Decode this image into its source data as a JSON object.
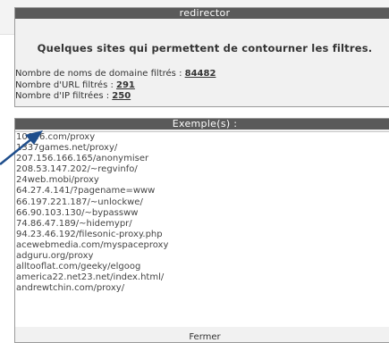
{
  "panel_title": "redirector",
  "subtitle": "Quelques sites qui permettent de contourner les filtres.",
  "stats": [
    {
      "label": "Nombre de noms de domaine filtrés : ",
      "value": "84482"
    },
    {
      "label": "Nombre d'URL filtrés : ",
      "value": "291"
    },
    {
      "label": "Nombre d'IP filtrées : ",
      "value": "250"
    }
  ],
  "examples_title": "Exemple(s) :",
  "examples": [
    "100ff6.com/proxy",
    "1337games.net/proxy/",
    "207.156.166.165/anonymiser",
    "208.53.147.202/~regvinfo/",
    "24web.mobi/proxy",
    "64.27.4.141/?pagename=www",
    "66.197.221.187/~unlockwe/",
    "66.90.103.130/~bypassww",
    "74.86.47.189/~hidemypr/",
    "94.23.46.192/filesonic-proxy.php",
    "acewebmedia.com/myspaceproxy",
    "adguru.org/proxy",
    "alltooflat.com/geeky/elgoog",
    "america22.net23.net/index.html/",
    "andrewtchin.com/proxy/"
  ],
  "close_label": "Fermer"
}
